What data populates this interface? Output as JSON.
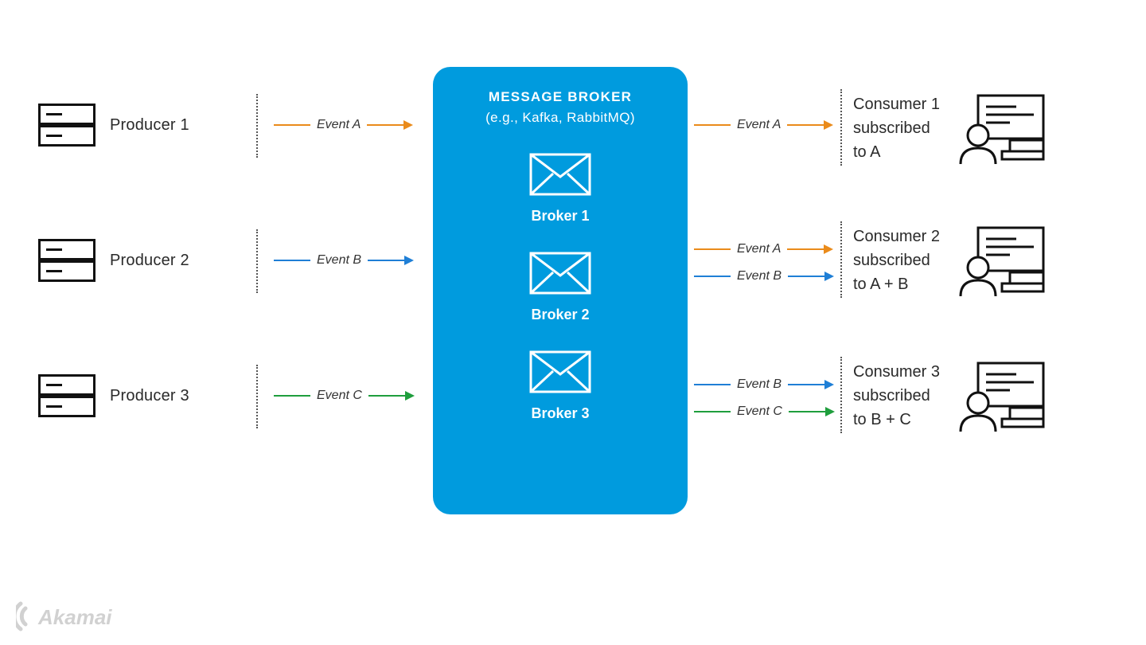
{
  "colors": {
    "accent": "#009bde",
    "orange": "#ea8b1b",
    "blue": "#1f7fd6",
    "green": "#1f9e3d"
  },
  "producers": [
    {
      "label": "Producer 1"
    },
    {
      "label": "Producer 2"
    },
    {
      "label": "Producer 3"
    }
  ],
  "left_events": [
    {
      "label": "Event A",
      "color": "orange"
    },
    {
      "label": "Event B",
      "color": "blue"
    },
    {
      "label": "Event C",
      "color": "green"
    }
  ],
  "broker": {
    "title": "MESSAGE BROKER",
    "subtitle": "(e.g., Kafka, RabbitMQ)",
    "items": [
      "Broker 1",
      "Broker 2",
      "Broker 3"
    ]
  },
  "right_event_groups": [
    [
      {
        "label": "Event A",
        "color": "orange"
      }
    ],
    [
      {
        "label": "Event A",
        "color": "orange"
      },
      {
        "label": "Event B",
        "color": "blue"
      }
    ],
    [
      {
        "label": "Event B",
        "color": "blue"
      },
      {
        "label": "Event C",
        "color": "green"
      }
    ]
  ],
  "consumers": [
    {
      "line1": "Consumer 1",
      "line2": "subscribed",
      "line3": "to A"
    },
    {
      "line1": "Consumer 2",
      "line2": "subscribed",
      "line3": "to A + B"
    },
    {
      "line1": "Consumer 3",
      "line2": "subscribed",
      "line3": "to B + C"
    }
  ],
  "logo_text": "Akamai"
}
